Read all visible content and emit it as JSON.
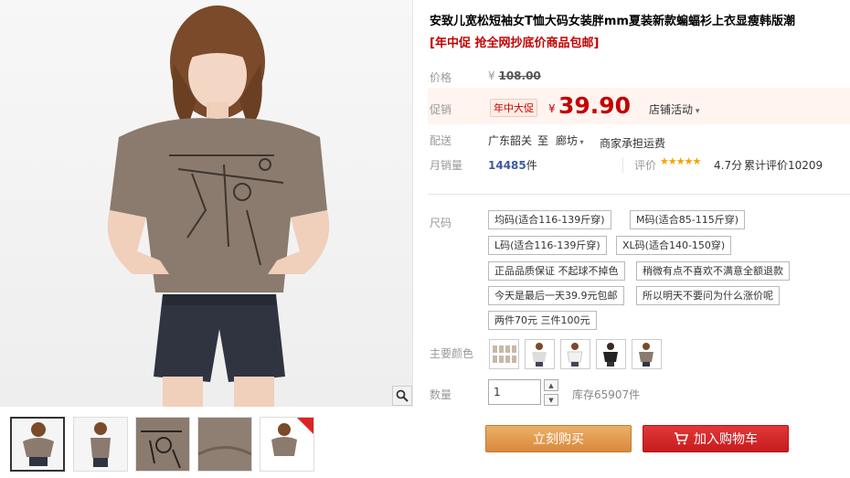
{
  "product": {
    "title": "安致儿宽松短袖女T恤大码女装胖mm夏装新款蝙蝠衫上衣显瘦韩版潮",
    "subtitle": "[年中促 抢全网抄底价商品包邮]"
  },
  "price": {
    "label": "价格",
    "currency": "¥",
    "original": "108.00"
  },
  "promo": {
    "label": "促销",
    "badge": "年中大促",
    "currency": "¥",
    "price": "39.90",
    "shop_activity": "店铺活动"
  },
  "shipping": {
    "label": "配送",
    "from": "广东韶关",
    "to_word": "至",
    "dest": "廊坊",
    "note": "商家承担运费"
  },
  "sales": {
    "label": "月销量",
    "count": "14485",
    "unit": "件",
    "rating_label": "评价",
    "stars": "★★★★★",
    "rating": "4.7分",
    "review_count": "累计评价10209"
  },
  "options": {
    "size_label": "尺码",
    "sizes": [
      "均码(适合116-139斤穿)",
      "M码(适合85-115斤穿)",
      "L码(适合116-139斤穿)",
      "XL码(适合140-150穿)",
      "正品品质保证 不起球不掉色",
      "稍微有点不喜欢不满意全额退款",
      "今天是最后一天39.9元包邮",
      "所以明天不要问为什么涨价呢",
      "两件70元 三件100元"
    ],
    "color_label": "主要颜色"
  },
  "quantity": {
    "label": "数量",
    "value": "1",
    "stock": "库存65907件"
  },
  "buttons": {
    "buy_now": "立刻购买",
    "add_cart": "加入购物车"
  },
  "colors": {
    "price_red": "#c40000",
    "buy_orange": "#d9893c",
    "cart_red": "#c71c1e",
    "star_gold": "#f5a300"
  }
}
